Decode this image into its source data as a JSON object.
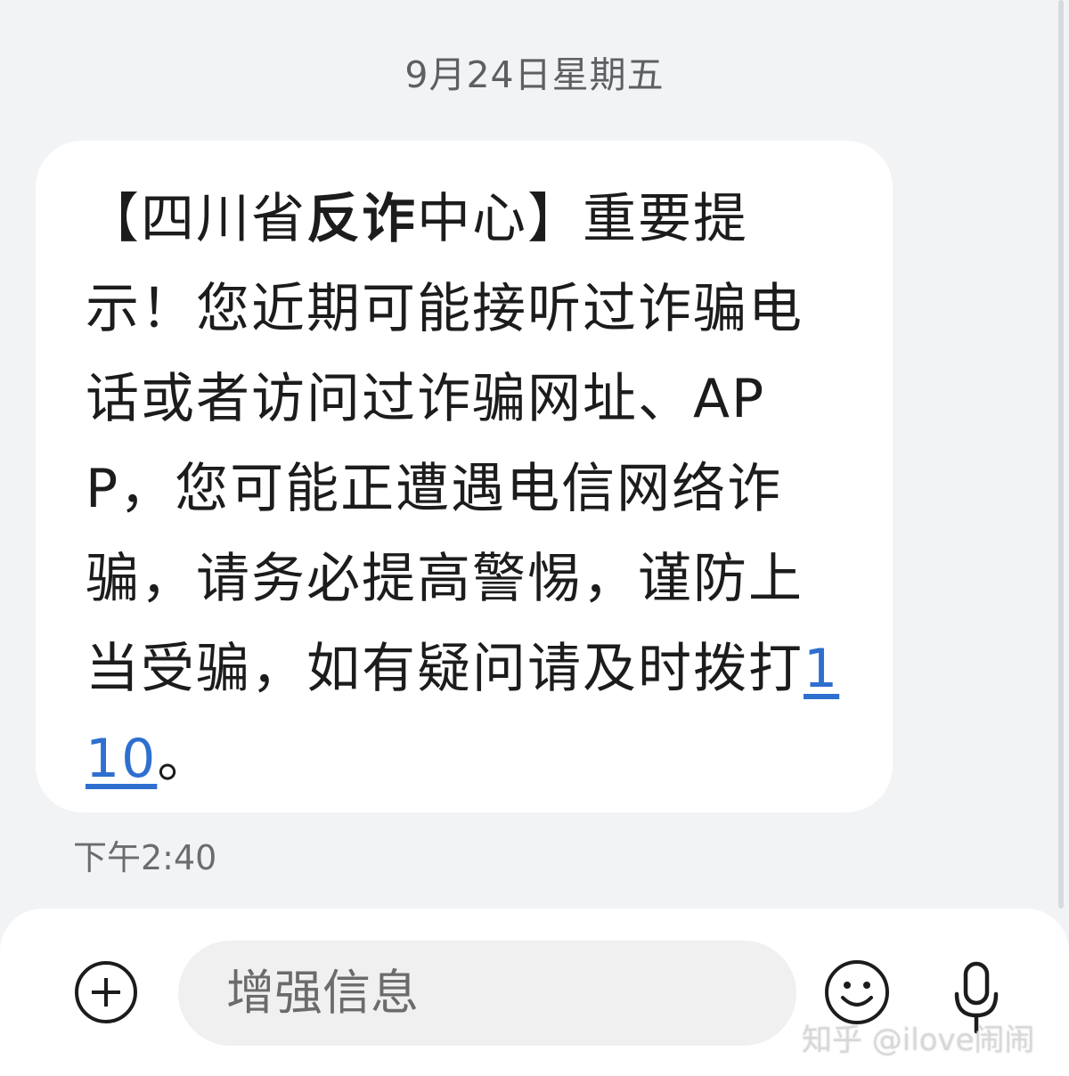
{
  "conversation": {
    "date_header": "9月24日星期五",
    "message": {
      "part1": "【四川省",
      "part2_bold": "反诈",
      "part3": "中心】重要提示！您近期可能接听过诈骗电话或者访问过诈骗网址、APP，您可能正遭遇电信网络诈骗，请务必提高警惕，谨防上当受骗，如有疑问请及时拨打",
      "phone_link": "110",
      "part4": "。",
      "time": "下午2:40"
    }
  },
  "composer": {
    "placeholder": "增强信息",
    "icons": {
      "add": "add-circle-icon",
      "emoji": "emoji-icon",
      "mic": "microphone-icon"
    }
  },
  "watermark": "知乎 @ilove闹闹",
  "colors": {
    "background": "#f1f3f5",
    "bubble": "#ffffff",
    "link": "#2e6fcf"
  }
}
